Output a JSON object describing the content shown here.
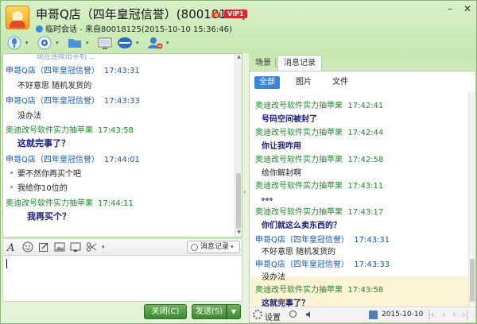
{
  "header": {
    "title": "申哥Q店（四年皇冠信誉）(80018125)",
    "vip_badge": "VIP1",
    "subtitle": "临时会话 - 来自80018125(2015-10-10  15:36:46)",
    "win_minimize": "–",
    "win_close": "✕"
  },
  "chat": {
    "top_partial": "现在连续出手机 ...",
    "messages": [
      {
        "sender": "申哥Q店（四年皇冠信誉）",
        "time": "17:43:31",
        "lines": [
          "不好意思  随机发货的"
        ]
      },
      {
        "sender": "申哥Q店（四年皇冠信誉）",
        "time": "17:43:33",
        "lines": [
          "没办法"
        ]
      },
      {
        "sender": "奥迪改号软件实力抽苹果",
        "time": "17:43:58",
        "lines": [
          "这就完事了？"
        ]
      },
      {
        "sender": "申哥Q店（四年皇冠信誉）",
        "time": "17:44:01",
        "lines": [
          "要不然你再买个吧",
          "我给你10位的"
        ]
      },
      {
        "sender": "奥迪改号软件实力抽苹果",
        "time": "17:44:11",
        "lines": [
          "我再买个？"
        ]
      }
    ]
  },
  "input_toolbar": {
    "history_label": "消息记录"
  },
  "buttons": {
    "close_label": "关闭(C)",
    "send_label": "发送(S)"
  },
  "right_panel": {
    "tabs": [
      "场景",
      "消息记录"
    ],
    "filters": [
      "全部",
      "图片",
      "文件"
    ],
    "records": [
      {
        "sender": "奥迪改号软件实力抽苹果",
        "time": "17:42:41",
        "text": "号码空间被封了"
      },
      {
        "sender": "奥迪改号软件实力抽苹果",
        "time": "17:42:44",
        "text": "你让我咋用"
      },
      {
        "sender": "奥迪改号软件实力抽苹果",
        "time": "17:42:58",
        "text": "给你解封啊"
      },
      {
        "sender": "奥迪改号软件实力抽苹果",
        "time": "17:43:11",
        "text": "。。。"
      },
      {
        "sender": "奥迪改号软件实力抽苹果",
        "time": "17:43:17",
        "text": "你们就这么卖东西的？"
      },
      {
        "sender": "申哥Q店（四年皇冠信誉）",
        "time": "17:43:31",
        "text": "不好意思  随机发货的"
      },
      {
        "sender": "申哥Q店（四年皇冠信誉）",
        "time": "17:43:33",
        "text": "没办法"
      },
      {
        "sender": "奥迪改号软件实力抽苹果",
        "time": "17:43:58",
        "text": "这就完事了？"
      }
    ],
    "footer": {
      "settings_label": "设置",
      "date": "2015-10-10"
    }
  },
  "colors": {
    "accent_green": "#3d8a32",
    "sender_blue": "#1557b0",
    "sender_green": "#1b8a28",
    "highlight": "#fdf4d6"
  }
}
